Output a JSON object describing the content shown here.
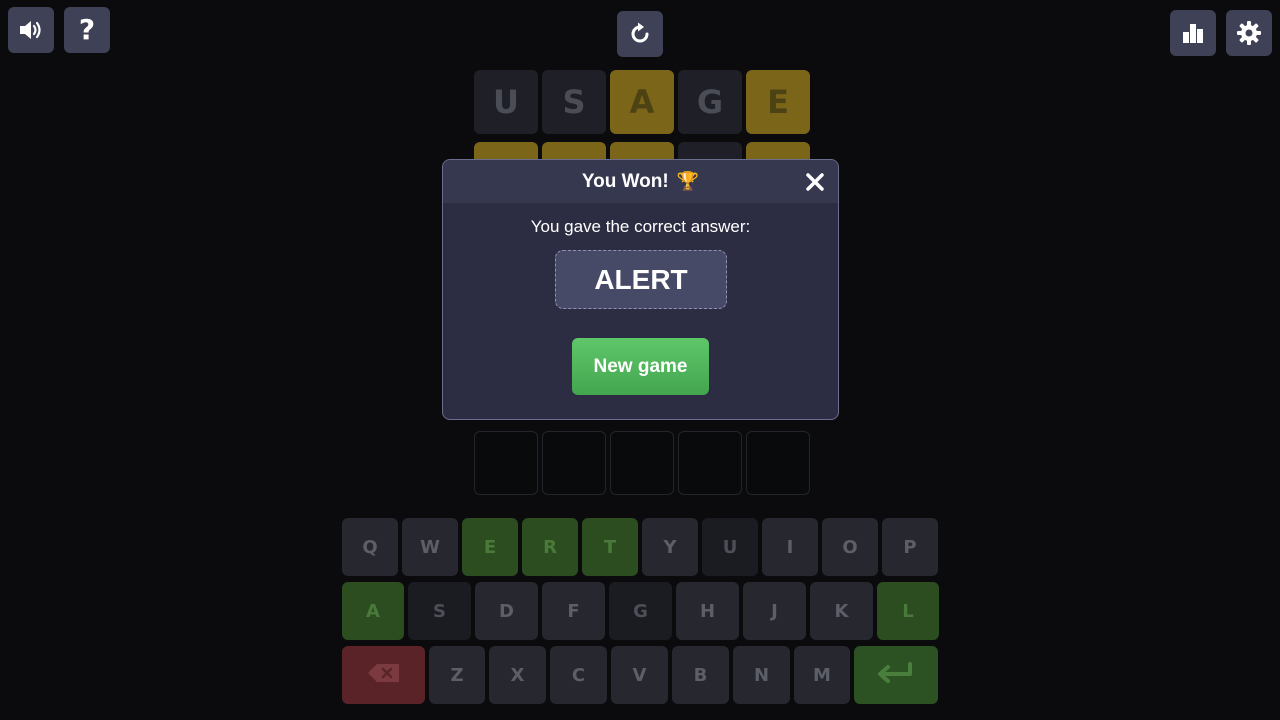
{
  "topbar": {
    "sound_icon": "speaker-icon",
    "help_label": "?",
    "restart_icon": "restart-icon",
    "stats_icon": "bar-chart-icon",
    "settings_icon": "gear-icon"
  },
  "board": {
    "rows": [
      [
        {
          "letter": "U",
          "state": "absent"
        },
        {
          "letter": "S",
          "state": "absent"
        },
        {
          "letter": "A",
          "state": "present"
        },
        {
          "letter": "G",
          "state": "absent"
        },
        {
          "letter": "E",
          "state": "present"
        }
      ]
    ],
    "partial_row_states": [
      "present",
      "present",
      "present",
      "absent",
      "present"
    ],
    "empty_row_count": 1
  },
  "keyboard": {
    "row1": [
      {
        "label": "Q",
        "state": "default"
      },
      {
        "label": "W",
        "state": "default"
      },
      {
        "label": "E",
        "state": "correct"
      },
      {
        "label": "R",
        "state": "correct"
      },
      {
        "label": "T",
        "state": "correct"
      },
      {
        "label": "Y",
        "state": "default"
      },
      {
        "label": "U",
        "state": "used"
      },
      {
        "label": "I",
        "state": "default"
      },
      {
        "label": "O",
        "state": "default"
      },
      {
        "label": "P",
        "state": "default"
      }
    ],
    "row2": [
      {
        "label": "A",
        "state": "correct"
      },
      {
        "label": "S",
        "state": "used"
      },
      {
        "label": "D",
        "state": "default"
      },
      {
        "label": "F",
        "state": "default"
      },
      {
        "label": "G",
        "state": "used"
      },
      {
        "label": "H",
        "state": "default"
      },
      {
        "label": "J",
        "state": "default"
      },
      {
        "label": "K",
        "state": "default"
      },
      {
        "label": "L",
        "state": "correct"
      }
    ],
    "row3": [
      {
        "label": "Z",
        "state": "default"
      },
      {
        "label": "X",
        "state": "default"
      },
      {
        "label": "C",
        "state": "default"
      },
      {
        "label": "V",
        "state": "default"
      },
      {
        "label": "B",
        "state": "default"
      },
      {
        "label": "N",
        "state": "default"
      },
      {
        "label": "M",
        "state": "default"
      }
    ],
    "backspace_icon": "backspace-icon",
    "enter_icon": "enter-icon"
  },
  "modal": {
    "title": "You Won!",
    "title_icon": "trophy-icon",
    "trophy_glyph": "🏆",
    "close_icon": "close-icon",
    "answer_label": "You gave the correct answer:",
    "answer": "ALERT",
    "new_game_label": "New game"
  },
  "colors": {
    "background": "#0b0b0d",
    "modal_bg": "#2c2d42",
    "button_green": "#4fb65b",
    "present": "#7a6519",
    "correct": "#3d6a2c",
    "top_button": "#3f4257"
  }
}
